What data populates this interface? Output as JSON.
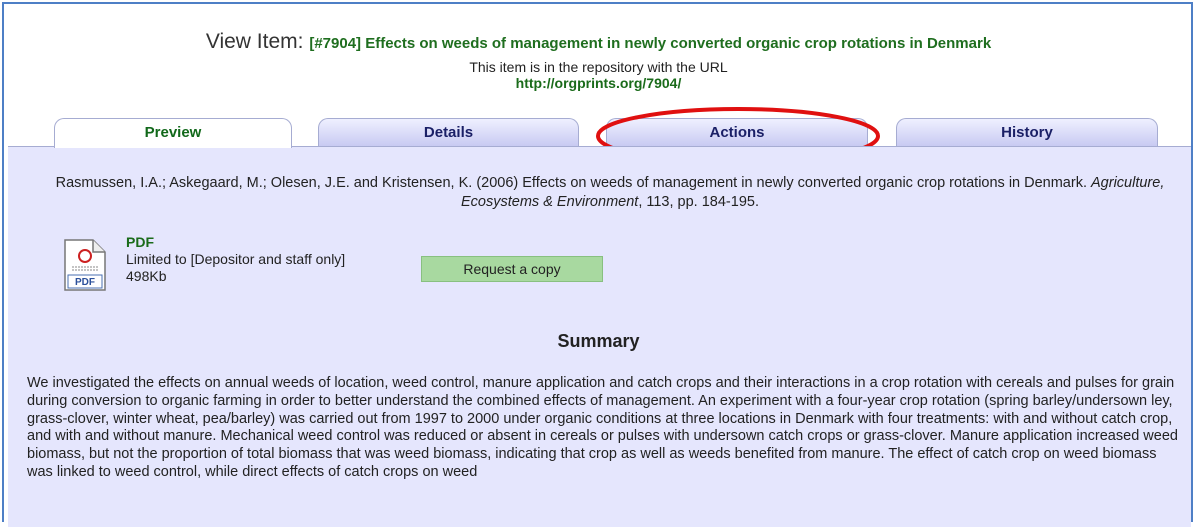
{
  "header": {
    "title_prefix": "View Item:",
    "title_link": "[#7904] Effects on weeds of management in newly converted organic crop rotations in Denmark",
    "repo_text": "This item is in the repository with the URL",
    "repo_url": "http://orgprints.org/7904/"
  },
  "tabs": [
    {
      "label": "Preview"
    },
    {
      "label": "Details"
    },
    {
      "label": "Actions"
    },
    {
      "label": "History"
    }
  ],
  "citation": {
    "authors_year_title": "Rasmussen, I.A.; Askegaard, M.; Olesen, J.E. and Kristensen, K. (2006) Effects on weeds of management in newly converted organic crop rotations in Denmark.",
    "journal": "Agriculture, Ecosystems & Environment",
    "details": ", 113, pp. 184-195."
  },
  "file": {
    "icon": "pdf-file-icon",
    "type": "PDF",
    "access": "Limited to [Depositor and staff only]",
    "size": "498Kb",
    "request_button": "Request a copy"
  },
  "summary": {
    "heading": "Summary",
    "text": "We investigated the effects on annual weeds of location, weed control, manure application and catch crops and their interactions in a crop rotation with cereals and pulses for grain during conversion to organic farming in order to better understand the combined effects of management. An experiment with a four-year crop rotation (spring barley/undersown ley, grass-clover, winter wheat, pea/barley) was carried out from 1997 to 2000 under organic conditions at three locations in Denmark with four treatments: with and without catch crop, and with and without manure. Mechanical weed control was reduced or absent in cereals or pulses with undersown catch crops or grass-clover. Manure application increased weed biomass, but not the proportion of total biomass that was weed biomass, indicating that crop as well as weeds benefited from manure. The effect of catch crop on weed biomass was linked to weed control, while direct effects of catch crops on weed"
  },
  "colors": {
    "frame_border": "#4e7fc6",
    "panel_bg": "#e5e6fd",
    "link_green": "#1a6b1a",
    "tab_text": "#1a1f66",
    "button_bg": "#a8d9a0",
    "highlight": "#e01010"
  }
}
